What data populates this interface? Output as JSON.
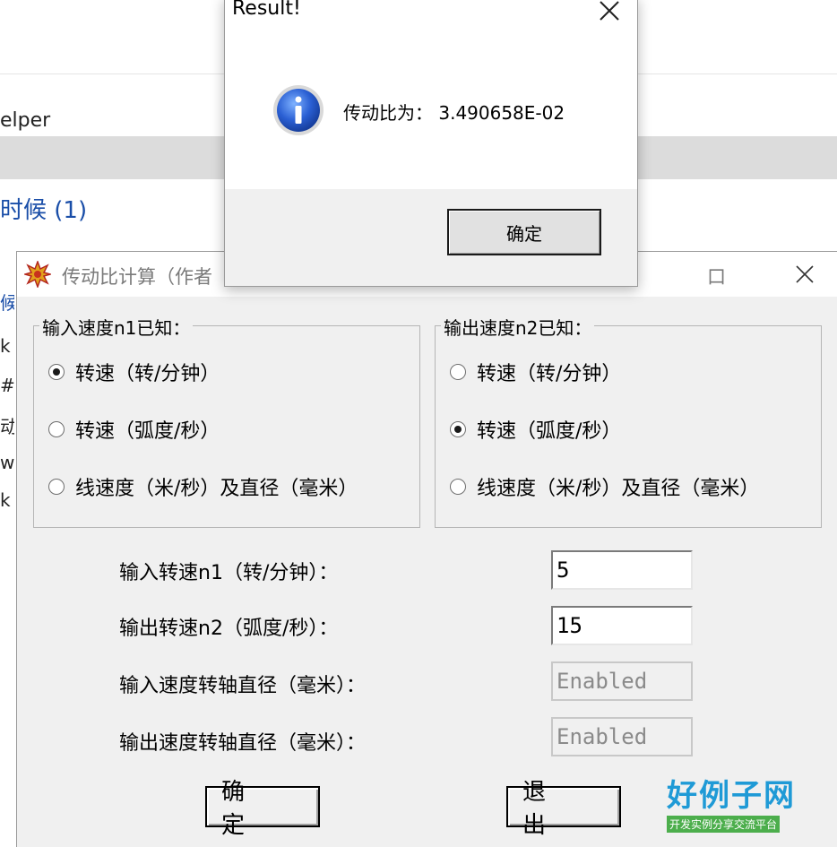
{
  "background": {
    "helper_text": "elper",
    "link_text": "时候 (1)",
    "strip_chars": [
      "候",
      "k",
      "#S",
      "动",
      "w",
      "k"
    ]
  },
  "main_dialog": {
    "title": "传动比计算（作者",
    "title_suffix": "口",
    "input_group": {
      "title": "输入速度n1已知：",
      "options": [
        {
          "label": "转速（转/分钟）",
          "checked": true
        },
        {
          "label": "转速（弧度/秒）",
          "checked": false
        },
        {
          "label": "线速度（米/秒）及直径（毫米）",
          "checked": false
        }
      ]
    },
    "output_group": {
      "title": "输出速度n2已知：",
      "options": [
        {
          "label": "转速（转/分钟）",
          "checked": false
        },
        {
          "label": "转速（弧度/秒）",
          "checked": true
        },
        {
          "label": "线速度（米/秒）及直径（毫米）",
          "checked": false
        }
      ]
    },
    "fields": [
      {
        "label": "输入转速n1（转/分钟）：",
        "value": "5",
        "enabled": true
      },
      {
        "label": "输出转速n2（弧度/秒）：",
        "value": "15",
        "enabled": true
      },
      {
        "label": "输入速度转轴直径（毫米）：",
        "value": "Enabled",
        "enabled": false
      },
      {
        "label": "输出速度转轴直径（毫米）：",
        "value": "Enabled",
        "enabled": false
      }
    ],
    "ok_label": "确 定",
    "exit_label": "退 出"
  },
  "result_dialog": {
    "title": "Result!",
    "message": "传动比为：  3.490658E-02",
    "ok_label": "确定"
  },
  "watermark": {
    "logo_text": "好例子网",
    "logo_subtext": "开发实例分享交流平台"
  },
  "icons": {
    "app_icon": "starburst-icon",
    "info_icon": "info-icon",
    "close_icon": "close-icon"
  }
}
